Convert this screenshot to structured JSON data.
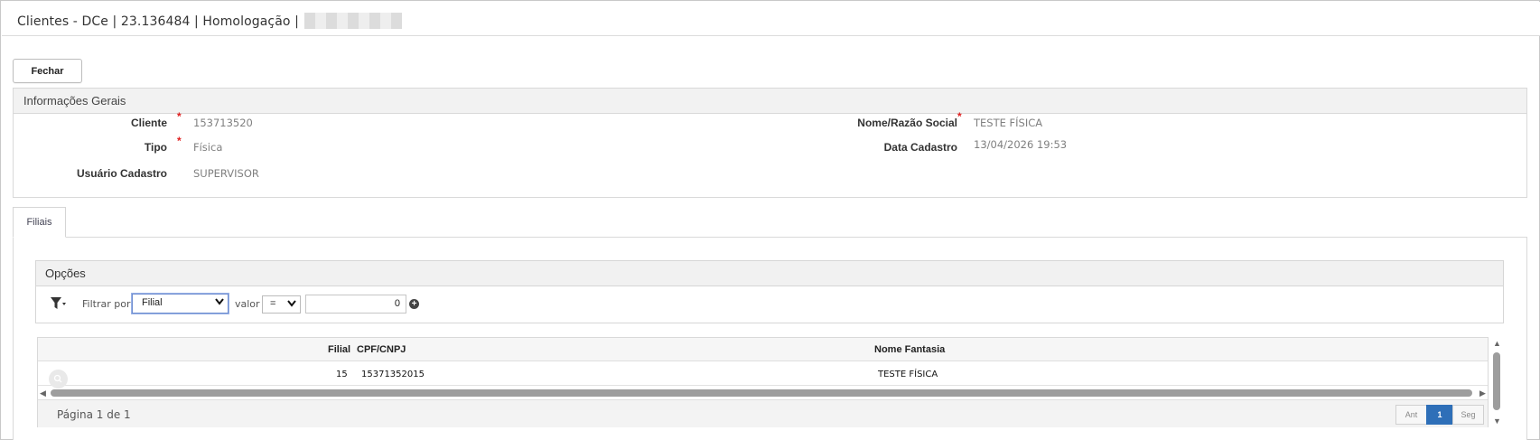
{
  "window": {
    "title": "Clientes - DCe | 23.136484 | Homologação |"
  },
  "toolbar": {
    "close_label": "Fechar"
  },
  "general": {
    "header": "Informações Gerais",
    "client_label": "Cliente",
    "client_value": "153713520",
    "type_label": "Tipo",
    "type_value": "Física",
    "user_label": "Usuário Cadastro",
    "user_value": "SUPERVISOR",
    "name_label": "Nome/Razão Social",
    "name_value": "TESTE FÍSICA",
    "date_label": "Data Cadastro",
    "date_value": "13/04/2026 19:53",
    "required_mark": "*"
  },
  "tabs": [
    {
      "label": "Filiais",
      "active": true
    }
  ],
  "options": {
    "header": "Opções",
    "filter_by_label": "Filtrar por",
    "filter_field_value": "Filial",
    "value_label": "valor",
    "operator_value": "=",
    "filter_value": "0"
  },
  "grid": {
    "columns": [
      "Filial",
      "CPF/CNPJ",
      "Nome Fantasia"
    ],
    "rows": [
      {
        "filial": "15",
        "cpf_cnpj": "15371352015",
        "nome_fantasia": "TESTE FÍSICA"
      }
    ],
    "pager": {
      "info": "Página 1 de 1",
      "prev_label": "Ant",
      "current_page": "1",
      "next_label": "Seg"
    }
  },
  "colors": {
    "accent": "#2e6fb8",
    "required": "#e02020"
  }
}
